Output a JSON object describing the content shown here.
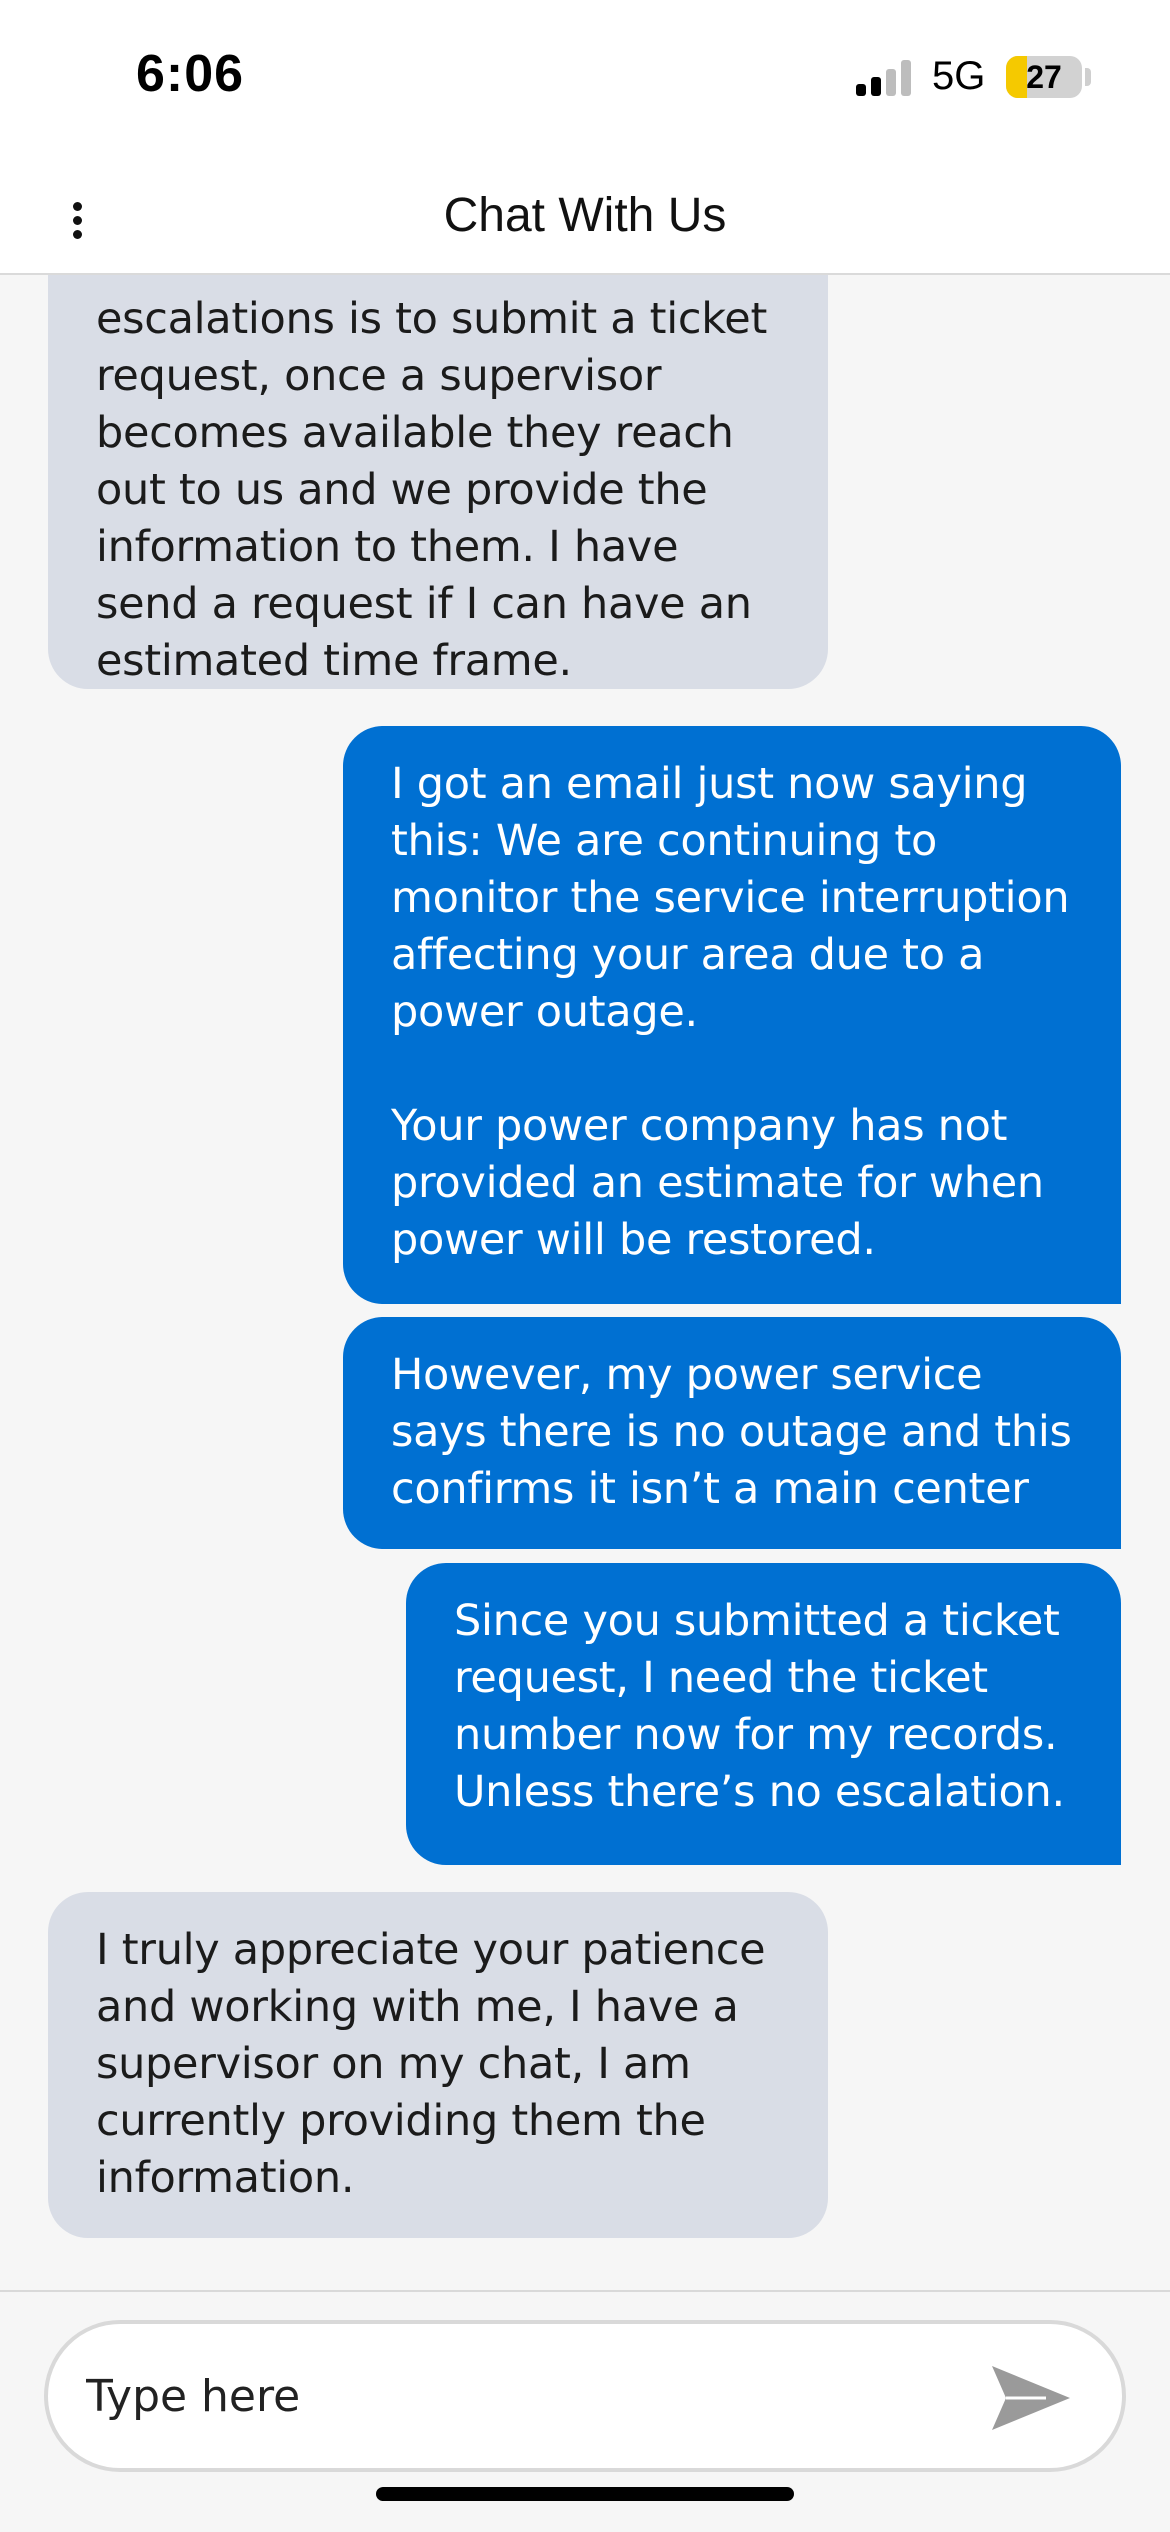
{
  "status_bar": {
    "time": "6:06",
    "network": "5G",
    "battery_level": "27",
    "battery_fraction": 0.27,
    "signal_bars_active": 2,
    "signal_bars_total": 4
  },
  "header": {
    "title": "Chat With Us",
    "menu_icon": "more-vertical-icon",
    "close_icon": "close-icon"
  },
  "messages": [
    {
      "sender": "agent",
      "paragraphs": [
        "escalations is to submit a ticket request, once a supervisor becomes available they reach out to us and we provide the information to them. I have send a request if I can have an estimated time frame."
      ]
    },
    {
      "sender": "user",
      "paragraphs": [
        "I got an email just now saying this: We are continuing to monitor the service interruption affecting your area due to a power outage.",
        "Your power company has not provided an estimate for when power will be restored."
      ]
    },
    {
      "sender": "user",
      "paragraphs": [
        "However, my power service says there is no outage and this confirms it isn’t a main center"
      ]
    },
    {
      "sender": "user",
      "paragraphs": [
        "Since you submitted a ticket request, I need the ticket number now for my records. Unless there’s no escalation."
      ]
    },
    {
      "sender": "agent",
      "paragraphs": [
        "I truly appreciate your patience and working with me, I have a supervisor on my chat, I am currently providing them the information."
      ]
    }
  ],
  "composer": {
    "placeholder": "Type here",
    "value": "",
    "send_icon": "send-icon"
  },
  "colors": {
    "user_bubble": "#0070d2",
    "agent_bubble": "#d9dde6",
    "background": "#f6f6f6",
    "battery_fill": "#f5c900"
  }
}
